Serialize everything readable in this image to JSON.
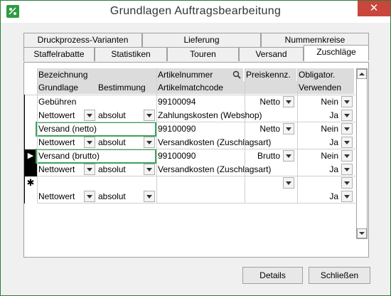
{
  "window": {
    "title": "Grundlagen Auftragsbearbeitung",
    "close_glyph": "✕"
  },
  "tabs_back": [
    "Druckprozess-Varianten",
    "Lieferung",
    "Nummernkreise"
  ],
  "tabs_front": [
    "Staffelrabatte",
    "Statistiken",
    "Touren",
    "Versand",
    "Zuschläge"
  ],
  "active_tab": "Zuschläge",
  "grid": {
    "header1": {
      "bezeichnung": "Bezeichnung",
      "artikelnummer": "Artikelnummer",
      "preiskennz": "Preiskennz.",
      "obligator": "Obligator."
    },
    "header2": {
      "grundlage": "Grundlage",
      "bestimmung": "Bestimmung",
      "artikelmatchcode": "Artikelmatchcode",
      "verwenden": "Verwenden"
    },
    "records": [
      {
        "bezeichnung": "Gebühren",
        "artikelnummer": "99100094",
        "preis": "Netto",
        "obligator": "Nein",
        "grundlage": "Nettowert",
        "bestimmung": "absolut",
        "matchcode": "Zahlungskosten (Webshop)",
        "verwenden": "Ja"
      },
      {
        "bezeichnung": "Versand (netto)",
        "artikelnummer": "99100090",
        "preis": "Netto",
        "obligator": "Nein",
        "grundlage": "Nettowert",
        "bestimmung": "absolut",
        "matchcode": "Versandkosten (Zuschlagsart)",
        "verwenden": "Ja"
      },
      {
        "bezeichnung": "Versand (brutto)",
        "artikelnummer": "99100090",
        "preis": "Brutto",
        "obligator": "Nein",
        "grundlage": "Nettowert",
        "bestimmung": "absolut",
        "matchcode": "Versandkosten (Zuschlagsart)",
        "verwenden": "Ja"
      }
    ],
    "new_record": {
      "grundlage": "Nettowert",
      "bestimmung": "absolut",
      "verwenden": "Ja"
    },
    "new_marker": "✱",
    "current_marker": "▶"
  },
  "buttons": {
    "details": "Details",
    "schliessen": "Schließen"
  },
  "colors": {
    "highlight": "#3aa35a",
    "close": "#c8463d",
    "app_icon": "#2e9c40"
  }
}
